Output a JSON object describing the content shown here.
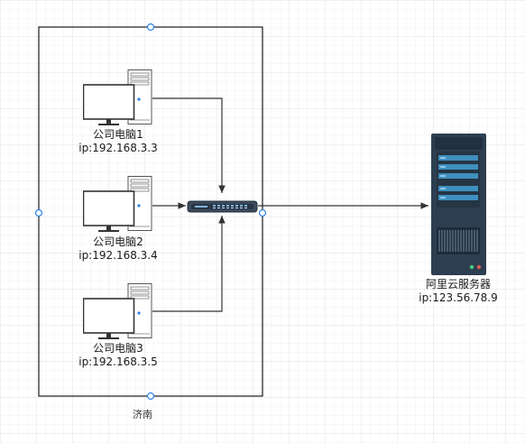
{
  "colors": {
    "grid_minor": "#f2f2f2",
    "grid_major": "#e4e4e4",
    "container_border": "#1a1a1a",
    "handle_stroke": "#2f80ed",
    "edge": "#333333",
    "server_body": "#2d3e50",
    "server_panel": "#3f8fbf",
    "switch_body": "#3c4a5c"
  },
  "region": {
    "label": "济南"
  },
  "computers": [
    {
      "name": "公司电脑1",
      "ip": "ip:192.168.3.3",
      "icon": "desktop-computer-icon"
    },
    {
      "name": "公司电脑2",
      "ip": "ip:192.168.3.4",
      "icon": "desktop-computer-icon"
    },
    {
      "name": "公司电脑3",
      "ip": "ip:192.168.3.5",
      "icon": "desktop-computer-icon"
    }
  ],
  "switch": {
    "icon": "network-switch-icon"
  },
  "server": {
    "name": "阿里云服务器",
    "ip": "ip:123.56.78.9",
    "icon": "server-rack-icon"
  }
}
